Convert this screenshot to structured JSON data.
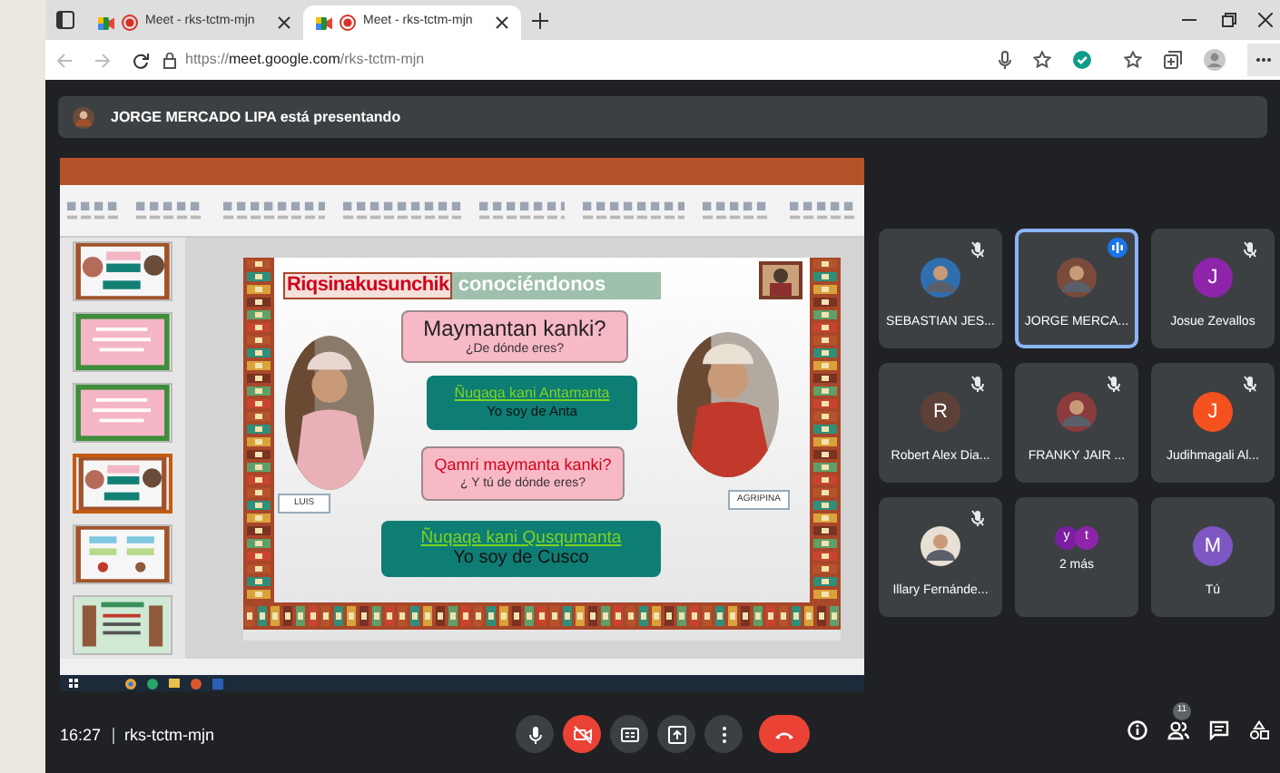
{
  "browser": {
    "tabs": [
      {
        "title": "Meet - rks-tctm-mjn",
        "selected": false,
        "recording": true
      },
      {
        "title": "Meet - rks-tctm-mjn",
        "selected": true,
        "recording": true
      }
    ],
    "url": {
      "scheme": "https://",
      "host": "meet.google.com",
      "path": "/rks-tctm-mjn"
    }
  },
  "presenter_banner": "JORGE MERCADO LIPA está presentando",
  "shared_screen": {
    "thumbnails": [
      {
        "kind": "dialog",
        "selected": false
      },
      {
        "kind": "pink",
        "selected": false
      },
      {
        "kind": "pink",
        "selected": false
      },
      {
        "kind": "dialog",
        "selected": true
      },
      {
        "kind": "cards",
        "selected": false
      },
      {
        "kind": "list",
        "selected": false
      }
    ],
    "slide": {
      "title_quechua": "Riqsinakusunchik",
      "title_spanish": "conociéndonos",
      "bubbles": [
        {
          "kind": "pink",
          "main": "Maymantan kanki?",
          "sub": "¿De dónde eres?"
        },
        {
          "kind": "teal",
          "main": "Ñuqaqa kani Antamanta",
          "sub": "Yo soy de Anta"
        },
        {
          "kind": "pink",
          "main": "Qamri maymanta kanki?",
          "sub": "¿ Y tú de dónde eres?"
        },
        {
          "kind": "teal",
          "main": "Ñuqaqa kani Qusqumanta",
          "sub": "Yo soy de Cusco"
        }
      ],
      "names": [
        "LUIS",
        "AGRIPINA"
      ]
    }
  },
  "participants": [
    {
      "name": "SEBASTIAN JES...",
      "muted": true,
      "speaking": false
    },
    {
      "name": "JORGE MERCA...",
      "muted": false,
      "speaking": true
    },
    {
      "kind": "letter",
      "initial": "J",
      "color": "#8e24aa",
      "name": "Josue Zevallos",
      "muted": true,
      "speaking": false
    },
    {
      "kind": "letter",
      "initial": "R",
      "color": "#5d4037",
      "name": "Robert Alex Dia...",
      "muted": true,
      "speaking": false
    },
    {
      "name": "FRANKY JAIR ...",
      "muted": true,
      "speaking": false
    },
    {
      "kind": "letter",
      "initial": "J",
      "color": "#f4511e",
      "name": "Judihmagali Al...",
      "muted": true,
      "speaking": false
    },
    {
      "name": "Illary Fernánde...",
      "muted": true,
      "speaking": false
    },
    {
      "kind": "group",
      "initials": [
        {
          "letter": "y",
          "color": "#7b1fa2"
        },
        {
          "letter": "t",
          "color": "#8e24aa"
        }
      ],
      "name": "2 más",
      "muted": false,
      "speaking": false
    },
    {
      "kind": "letter",
      "initial": "M",
      "color": "#7e57c2",
      "name": "Tú",
      "muted": false,
      "speaking": false
    }
  ],
  "bottom_bar": {
    "time": "16:27",
    "meeting_code": "rks-tctm-mjn",
    "mic_on": true,
    "camera_on": false,
    "people_count": "11"
  }
}
